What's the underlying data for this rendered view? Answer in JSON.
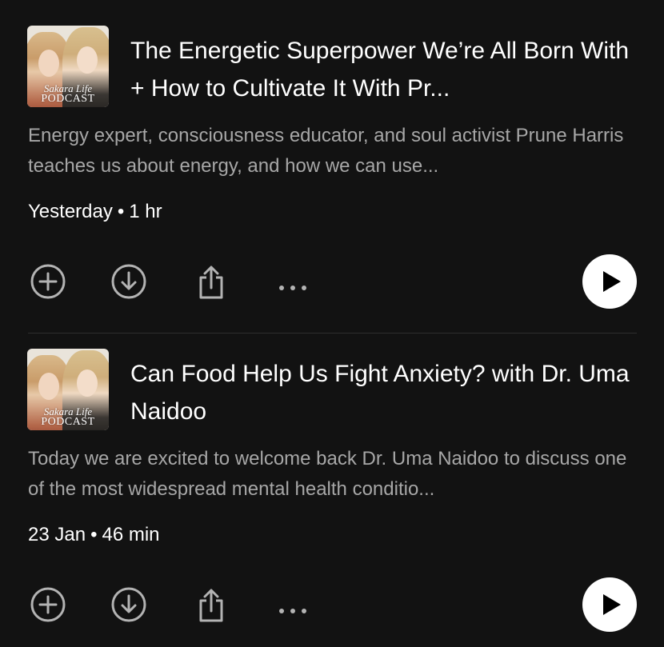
{
  "episodes": [
    {
      "cover": {
        "brand_line1": "Sakara Life",
        "brand_line2": "PODCAST"
      },
      "title": "The Energetic Superpower We’re All Born With + How to Cultivate It With Pr...",
      "description": "Energy expert, consciousness educator, and soul activist Prune Harris teaches us about energy, and how we can use...",
      "date": "Yesterday",
      "separator": "•",
      "duration": "1 hr",
      "icons": [
        "plus-circle-icon",
        "download-circle-icon",
        "share-icon",
        "more-icon",
        "play-icon"
      ]
    },
    {
      "cover": {
        "brand_line1": "Sakara Life",
        "brand_line2": "PODCAST"
      },
      "title": "Can Food Help Us Fight Anxiety? with Dr. Uma Naidoo",
      "description": "Today we are excited to welcome back Dr. Uma Naidoo to discuss one of the most widespread mental health conditio...",
      "date": "23 Jan",
      "separator": "•",
      "duration": "46 min",
      "icons": [
        "plus-circle-icon",
        "download-circle-icon",
        "share-icon",
        "more-icon",
        "play-icon"
      ]
    }
  ],
  "colors": {
    "background": "#121212",
    "primary_text": "#ffffff",
    "secondary_text": "#a7a7a7",
    "icon": "#b3b3b3",
    "divider": "#2e2e2e"
  }
}
